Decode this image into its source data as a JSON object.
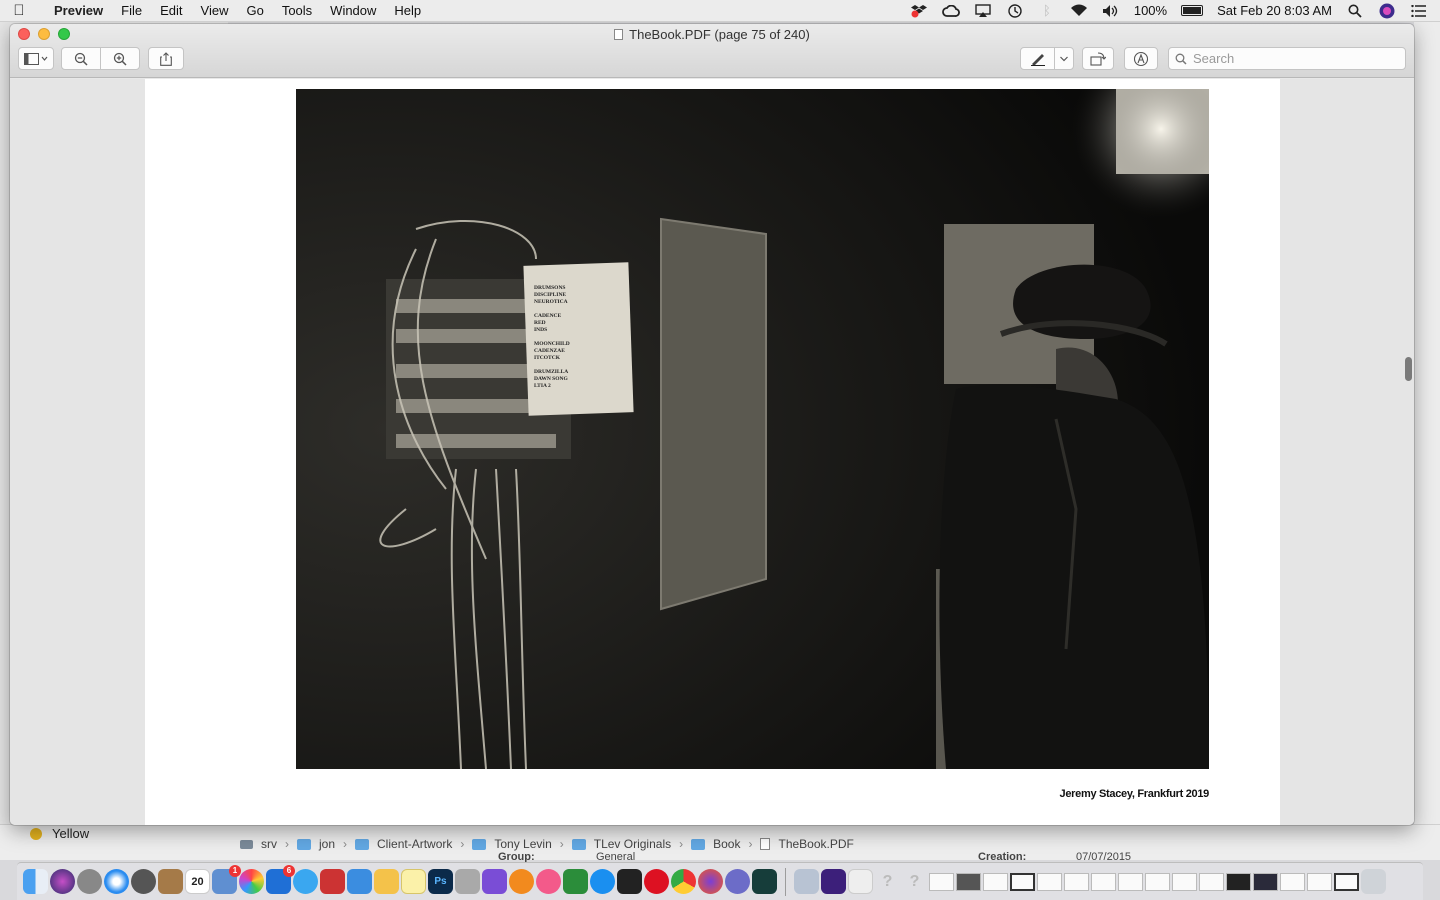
{
  "menubar": {
    "app_name": "Preview",
    "items": [
      "File",
      "Edit",
      "View",
      "Go",
      "Tools",
      "Window",
      "Help"
    ],
    "battery": "100%",
    "clock": "Sat Feb 20  8:03 AM"
  },
  "window": {
    "title": "TheBook.PDF (page 75 of 240)",
    "search_placeholder": "Search"
  },
  "document": {
    "photo_caption": "Jeremy Stacey, Frankfurt 2019",
    "setlist_lines": [
      "DRUMSONS",
      "DISCIPLINE",
      "NEUROTICA",
      "CADENCE",
      "RED",
      "INDS",
      "MOONCHILD",
      "CADENZAE",
      "ITCOTCK",
      "DRUMZILLA",
      "DAWN SONG",
      "LTIA 2"
    ]
  },
  "background": {
    "sidebar_item": "Yellow",
    "path": [
      "srv",
      "jon",
      "Client-Artwork",
      "Tony Levin",
      "TLev Originals",
      "Book",
      "TheBook.PDF"
    ],
    "ghost_left": "Group:",
    "ghost_left_value": "General",
    "ghost_right": "Creation:",
    "ghost_right_value": "07/07/2015"
  },
  "colors": {
    "accent_blue": "#62a8e3",
    "close_red": "#fc605c",
    "minimize_yellow": "#fdbc40",
    "zoom_green": "#34c84a"
  },
  "dock": {
    "badges": {
      "calendar": "20",
      "mail": "1",
      "xcode": "6"
    }
  }
}
